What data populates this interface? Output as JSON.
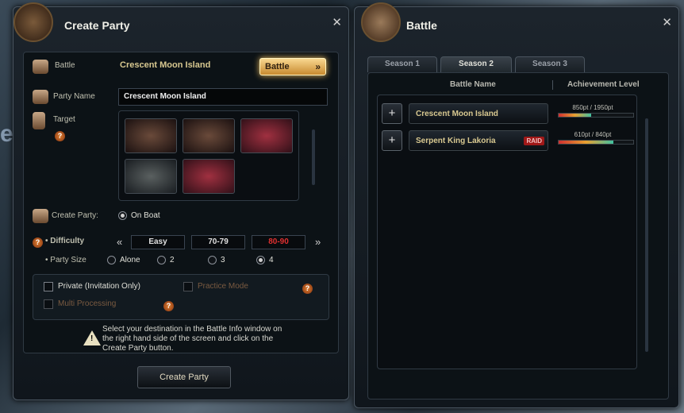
{
  "create_party": {
    "title": "Create Party",
    "battle_label": "Battle",
    "battle_value": "Crescent Moon Island",
    "battle_button": "Battle",
    "party_name_label": "Party Name",
    "party_name_value": "Crescent Moon Island",
    "target_label": "Target",
    "create_party_label": "Create Party:",
    "on_boat": "On Boat",
    "difficulty_label": "Difficulty",
    "difficulty_options": [
      "Easy",
      "70-79",
      "80-90"
    ],
    "party_size_label": "Party Size",
    "party_size_options": [
      "Alone",
      "2",
      "3",
      "4"
    ],
    "private_label": "Private (Invitation Only)",
    "practice_label": "Practice Mode",
    "multi_label": "Multi Processing",
    "info_text": "Select your destination in the Battle Info window on the right hand side of the screen and click on the Create Party button.",
    "create_button": "Create Party"
  },
  "battle": {
    "title": "Battle",
    "tabs": [
      "Season 1",
      "Season 2",
      "Season 3"
    ],
    "active_tab": 1,
    "col_battle_name": "Battle Name",
    "col_achievement": "Achievement Level",
    "rows": [
      {
        "name": "Crescent Moon Island",
        "raid": "",
        "pts": "850pt / 1950pt",
        "progress": 0.44
      },
      {
        "name": "Serpent King Lakoria",
        "raid": "RAID",
        "pts": "610pt / 840pt",
        "progress": 0.73
      }
    ]
  },
  "colors": {
    "accent_gold": "#d8c890",
    "raid_red": "#a01818",
    "difficulty_selected": "#e03030"
  }
}
